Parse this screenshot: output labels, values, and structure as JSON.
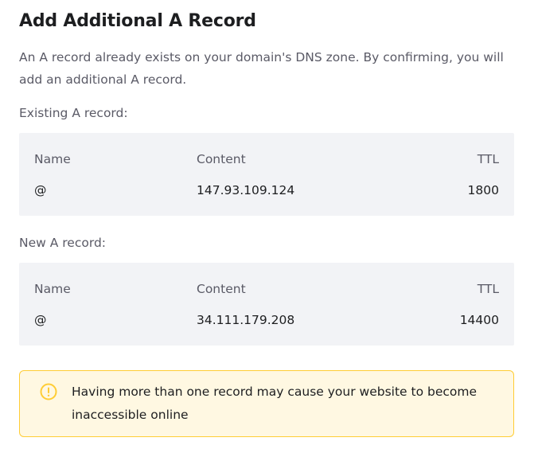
{
  "dialog": {
    "title": "Add Additional A Record",
    "description": "An A record already exists on your domain's DNS zone. By confirming, you will add an additional A record."
  },
  "existing_record": {
    "label": "Existing A record:",
    "headers": {
      "name": "Name",
      "content": "Content",
      "ttl": "TTL"
    },
    "values": {
      "name": "@",
      "content": "147.93.109.124",
      "ttl": "1800"
    }
  },
  "new_record": {
    "label": "New A record:",
    "headers": {
      "name": "Name",
      "content": "Content",
      "ttl": "TTL"
    },
    "values": {
      "name": "@",
      "content": "34.111.179.208",
      "ttl": "14400"
    }
  },
  "warning": {
    "icon": "exclamation-circle-icon",
    "text": "Having more than one record may cause your website to become inaccessible online",
    "accent_color": "#ffcd35",
    "background_color": "#fff8e2"
  },
  "colors": {
    "title": "#1d1e20",
    "muted_text": "#5a5a66",
    "record_background": "#f2f3f6"
  }
}
